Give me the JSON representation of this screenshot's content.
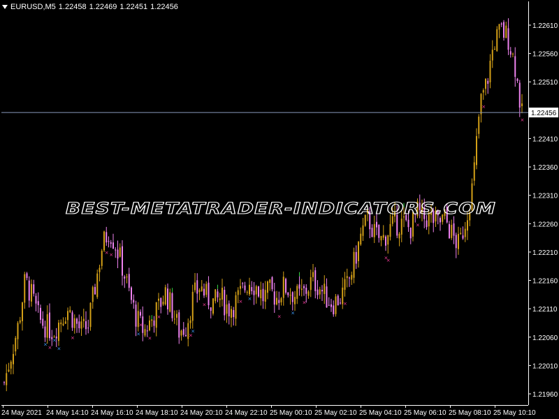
{
  "header": {
    "symbol": "EURUSD,M5",
    "ohlc": [
      "1.22458",
      "1.22469",
      "1.22451",
      "1.22456"
    ]
  },
  "watermark": "BEST-METATRADER-INDICATORS.COM",
  "colors": {
    "background": "#000000",
    "candle_bull": "#d4a017",
    "candle_bear": "#ee82ee",
    "marker_x": "#ff3fa0",
    "marker_blue": "#40a0ff",
    "marker_green": "#30d040",
    "current_price_line": "#8899bb",
    "axis": "#ffffff"
  },
  "chart_data": {
    "type": "candlestick",
    "symbol": "EURUSD",
    "timeframe": "M5",
    "ylim": [
      1.2194,
      1.2263
    ],
    "y_ticks": [
      "1.22610",
      "1.22560",
      "1.22510",
      "1.22410",
      "1.22360",
      "1.22310",
      "1.22260",
      "1.22210",
      "1.22160",
      "1.22110",
      "1.22060",
      "1.22010",
      "1.21960"
    ],
    "current_price": "1.22456",
    "x_ticks": [
      "24 May 2021",
      "24 May 14:10",
      "24 May 16:10",
      "24 May 18:10",
      "24 May 20:10",
      "24 May 22:10",
      "25 May 00:10",
      "25 May 02:10",
      "25 May 04:10",
      "25 May 06:10",
      "25 May 08:10",
      "25 May 10:10"
    ],
    "close_path": [
      1.2198,
      1.2203,
      1.2208,
      1.2216,
      1.2213,
      1.2209,
      1.2208,
      1.2207,
      1.2209,
      1.2211,
      1.2209,
      1.2207,
      1.2208,
      1.2215,
      1.2222,
      1.2225,
      1.2222,
      1.2218,
      1.2213,
      1.2209,
      1.2207,
      1.2209,
      1.2211,
      1.2214,
      1.2211,
      1.2207,
      1.2208,
      1.2213,
      1.2215,
      1.2213,
      1.2212,
      1.2213,
      1.2211,
      1.2212,
      1.2214,
      1.2216,
      1.2215,
      1.2213,
      1.2214,
      1.2213,
      1.2215,
      1.2214,
      1.2213,
      1.2214,
      1.2216,
      1.2215,
      1.2213,
      1.2212,
      1.2213,
      1.2215,
      1.2219,
      1.2224,
      1.2227,
      1.2224,
      1.2223,
      1.2225,
      1.2226,
      1.2226,
      1.2225,
      1.2228,
      1.2227,
      1.2227,
      1.2226,
      1.2227,
      1.2224,
      1.2222,
      1.2227,
      1.2233,
      1.2247,
      1.2251,
      1.2258,
      1.226,
      1.2259,
      1.2254,
      1.2245
    ]
  }
}
